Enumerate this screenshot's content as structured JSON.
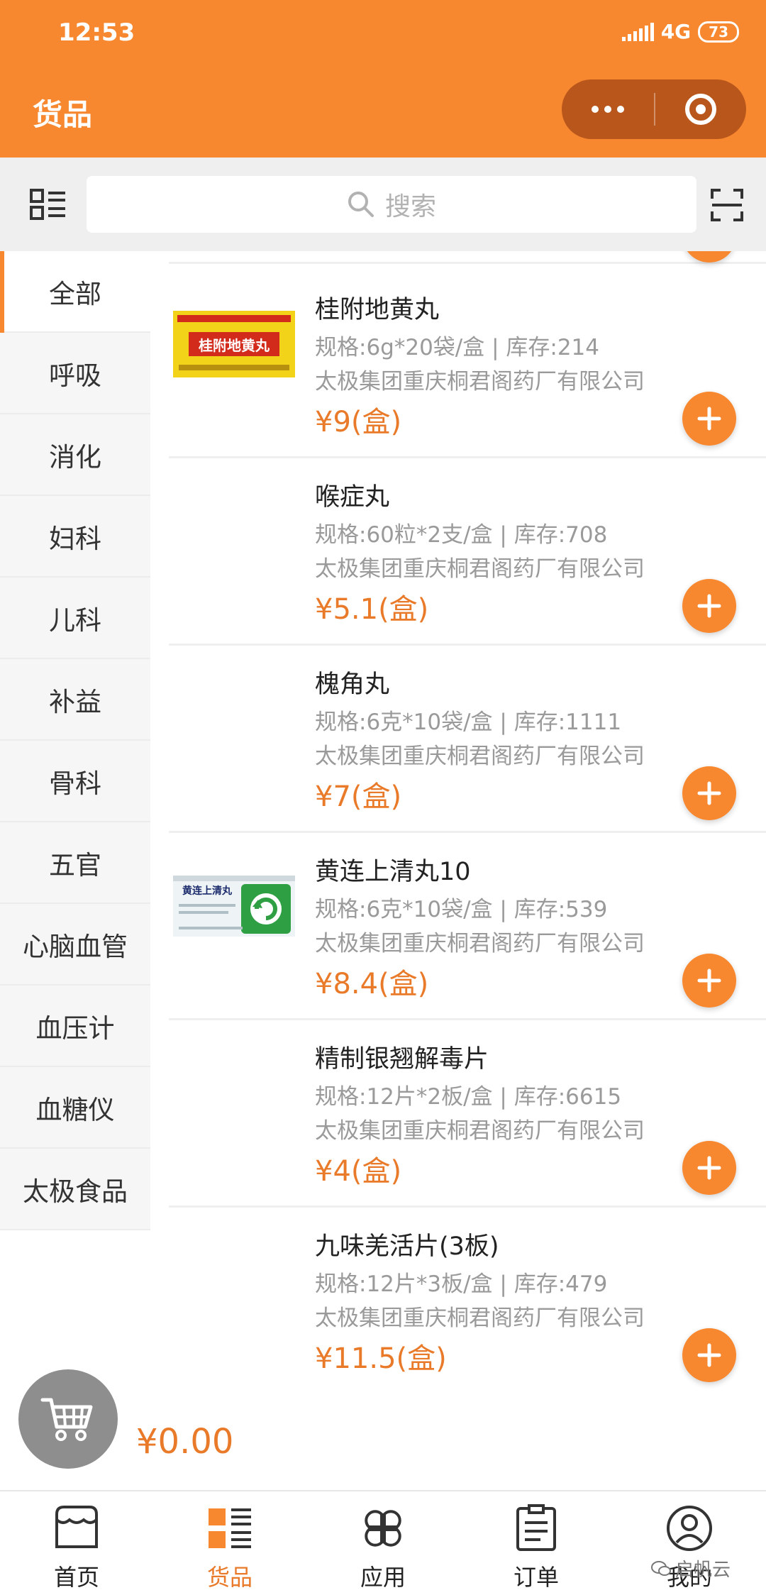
{
  "status_bar": {
    "time": "12:53",
    "network": "4G",
    "battery": "73"
  },
  "header": {
    "title": "货品"
  },
  "search": {
    "placeholder": "搜索"
  },
  "sidebar": {
    "items": [
      {
        "label": "全部",
        "active": true
      },
      {
        "label": "呼吸"
      },
      {
        "label": "消化"
      },
      {
        "label": "妇科"
      },
      {
        "label": "儿科"
      },
      {
        "label": "补益"
      },
      {
        "label": "骨科"
      },
      {
        "label": "五官"
      },
      {
        "label": "心脑血管"
      },
      {
        "label": "血压计"
      },
      {
        "label": "血糖仪"
      },
      {
        "label": "太极食品"
      }
    ]
  },
  "products": [
    {
      "name": "桂附地黄丸",
      "spec": "规格:6g*20袋/盒 | 库存:214",
      "company": "太极集团重庆桐君阁药厂有限公司",
      "price": "¥9(盒)",
      "image_text": "桂附地黄丸"
    },
    {
      "name": "喉症丸",
      "spec": "规格:60粒*2支/盒 | 库存:708",
      "company": "太极集团重庆桐君阁药厂有限公司",
      "price": "¥5.1(盒)"
    },
    {
      "name": "槐角丸",
      "spec": "规格:6克*10袋/盒 | 库存:1111",
      "company": "太极集团重庆桐君阁药厂有限公司",
      "price": "¥7(盒)"
    },
    {
      "name": "黄连上清丸10",
      "spec": "规格:6克*10袋/盒 | 库存:539",
      "company": "太极集团重庆桐君阁药厂有限公司",
      "price": "¥8.4(盒)",
      "image_text": "黄连上清丸"
    },
    {
      "name": "精制银翘解毒片",
      "spec": "规格:12片*2板/盒 | 库存:6615",
      "company": "太极集团重庆桐君阁药厂有限公司",
      "price": "¥4(盒)"
    },
    {
      "name": "九味羌活片(3板)",
      "spec": "规格:12片*3板/盒 | 库存:479",
      "company": "太极集团重庆桐君阁药厂有限公司",
      "price": "¥11.5(盒)"
    }
  ],
  "cart": {
    "total": "¥0.00"
  },
  "tabbar": {
    "items": [
      {
        "label": "首页",
        "icon": "shop-icon"
      },
      {
        "label": "货品",
        "icon": "goods-list-icon",
        "active": true
      },
      {
        "label": "应用",
        "icon": "apps-icon"
      },
      {
        "label": "订单",
        "icon": "order-icon"
      },
      {
        "label": "我的",
        "icon": "user-icon"
      }
    ]
  },
  "watermark": "启帆云",
  "colors": {
    "accent": "#f7882f",
    "price": "#e97a29",
    "capsule": "#b9561b"
  }
}
